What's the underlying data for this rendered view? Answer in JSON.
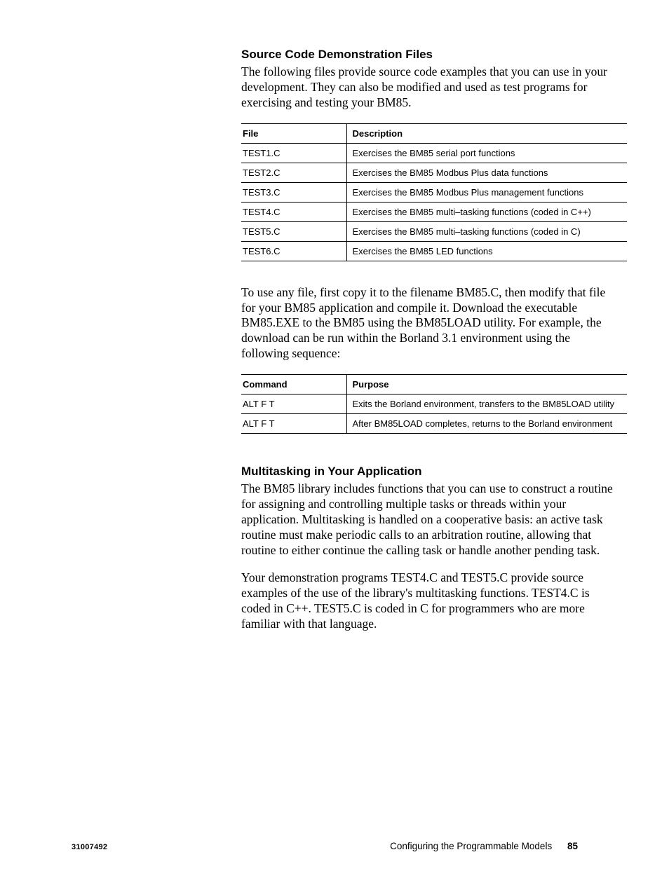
{
  "section1": {
    "heading": "Source Code Demonstration Files",
    "intro": "The following files provide source code examples that you can use in your development.  They can also be modified and used as test programs for exercising and testing your BM85."
  },
  "table1": {
    "headers": {
      "c1": "File",
      "c2": "Description"
    },
    "rows": [
      {
        "c1": "TEST1.C",
        "c2": "Exercises the BM85 serial port functions"
      },
      {
        "c1": "TEST2.C",
        "c2": "Exercises the BM85 Modbus Plus data functions"
      },
      {
        "c1": "TEST3.C",
        "c2": "Exercises the BM85 Modbus Plus management functions"
      },
      {
        "c1": "TEST4.C",
        "c2": "Exercises the BM85 multi–tasking functions (coded in C++)"
      },
      {
        "c1": "TEST5.C",
        "c2": "Exercises the BM85 multi–tasking functions (coded in C)"
      },
      {
        "c1": "TEST6.C",
        "c2": "Exercises the BM85 LED functions"
      }
    ]
  },
  "howto": {
    "text": "To use any file, first copy it to the filename BM85.C, then modify that file for your BM85 application and compile it.  Download the executable BM85.EXE to the BM85 using the BM85LOAD utility.  For example, the download can be run within the Borland 3.1 environment using the following sequence:"
  },
  "table2": {
    "headers": {
      "c1": "Command",
      "c2": "Purpose"
    },
    "rows": [
      {
        "c1": "ALT  F   T",
        "c2": "Exits the Borland environment, transfers to the BM85LOAD utility"
      },
      {
        "c1": "ALT  F   T",
        "c2": "After BM85LOAD completes, returns to the Borland environment"
      }
    ]
  },
  "section2": {
    "heading": "Multitasking in Your Application",
    "p1": "The BM85 library includes functions that you can use to construct a routine for assigning and controlling multiple tasks or threads within your application.  Multitasking is handled on a cooperative basis:  an active task routine must make periodic calls to an arbitration routine, allowing that routine to either continue the calling task or handle another pending task.",
    "p2": "Your demonstration programs TEST4.C and TEST5.C provide source examples of the use of the library's multitasking functions.  TEST4.C is coded in C++.  TEST5.C is coded in C for programmers who are more familiar with that language."
  },
  "footer": {
    "left": "31007492",
    "rightLabel": "Configuring the Programmable Models",
    "pageNo": "85"
  }
}
